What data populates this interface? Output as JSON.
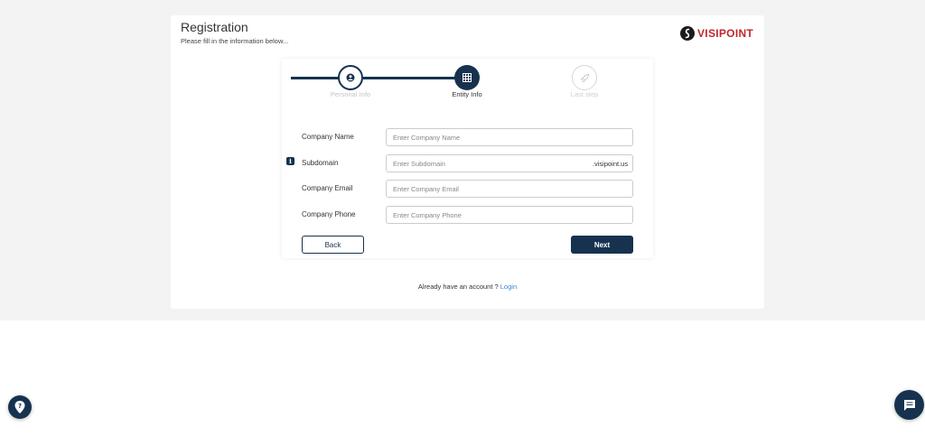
{
  "header": {
    "title": "Registration",
    "subtitle": "Please fill in the information below...",
    "logo_text": "VISIPOINT"
  },
  "stepper": {
    "steps": [
      {
        "label": "Personal Info",
        "icon": "user-icon",
        "state": "completed"
      },
      {
        "label": "Entity Info",
        "icon": "grid-icon",
        "state": "active"
      },
      {
        "label": "Last step",
        "icon": "rocket-icon",
        "state": "pending"
      }
    ]
  },
  "form": {
    "company_name": {
      "label": "Company Name",
      "placeholder": "Enter Company Name",
      "value": ""
    },
    "subdomain": {
      "label": "Subdomain",
      "placeholder": "Enter Subdomain",
      "value": "",
      "suffix": ".visipoint.us",
      "info_icon": "i"
    },
    "company_email": {
      "label": "Company Email",
      "placeholder": "Enter Company Email",
      "value": ""
    },
    "company_phone": {
      "label": "Company Phone",
      "placeholder": "Enter Company Phone",
      "value": ""
    }
  },
  "actions": {
    "back_label": "Back",
    "next_label": "Next"
  },
  "footer": {
    "prompt": "Already have an account ?",
    "login_label": "Login"
  },
  "colors": {
    "primary": "#16324f",
    "brand_red": "#c0272d",
    "link": "#3a8ad6"
  }
}
